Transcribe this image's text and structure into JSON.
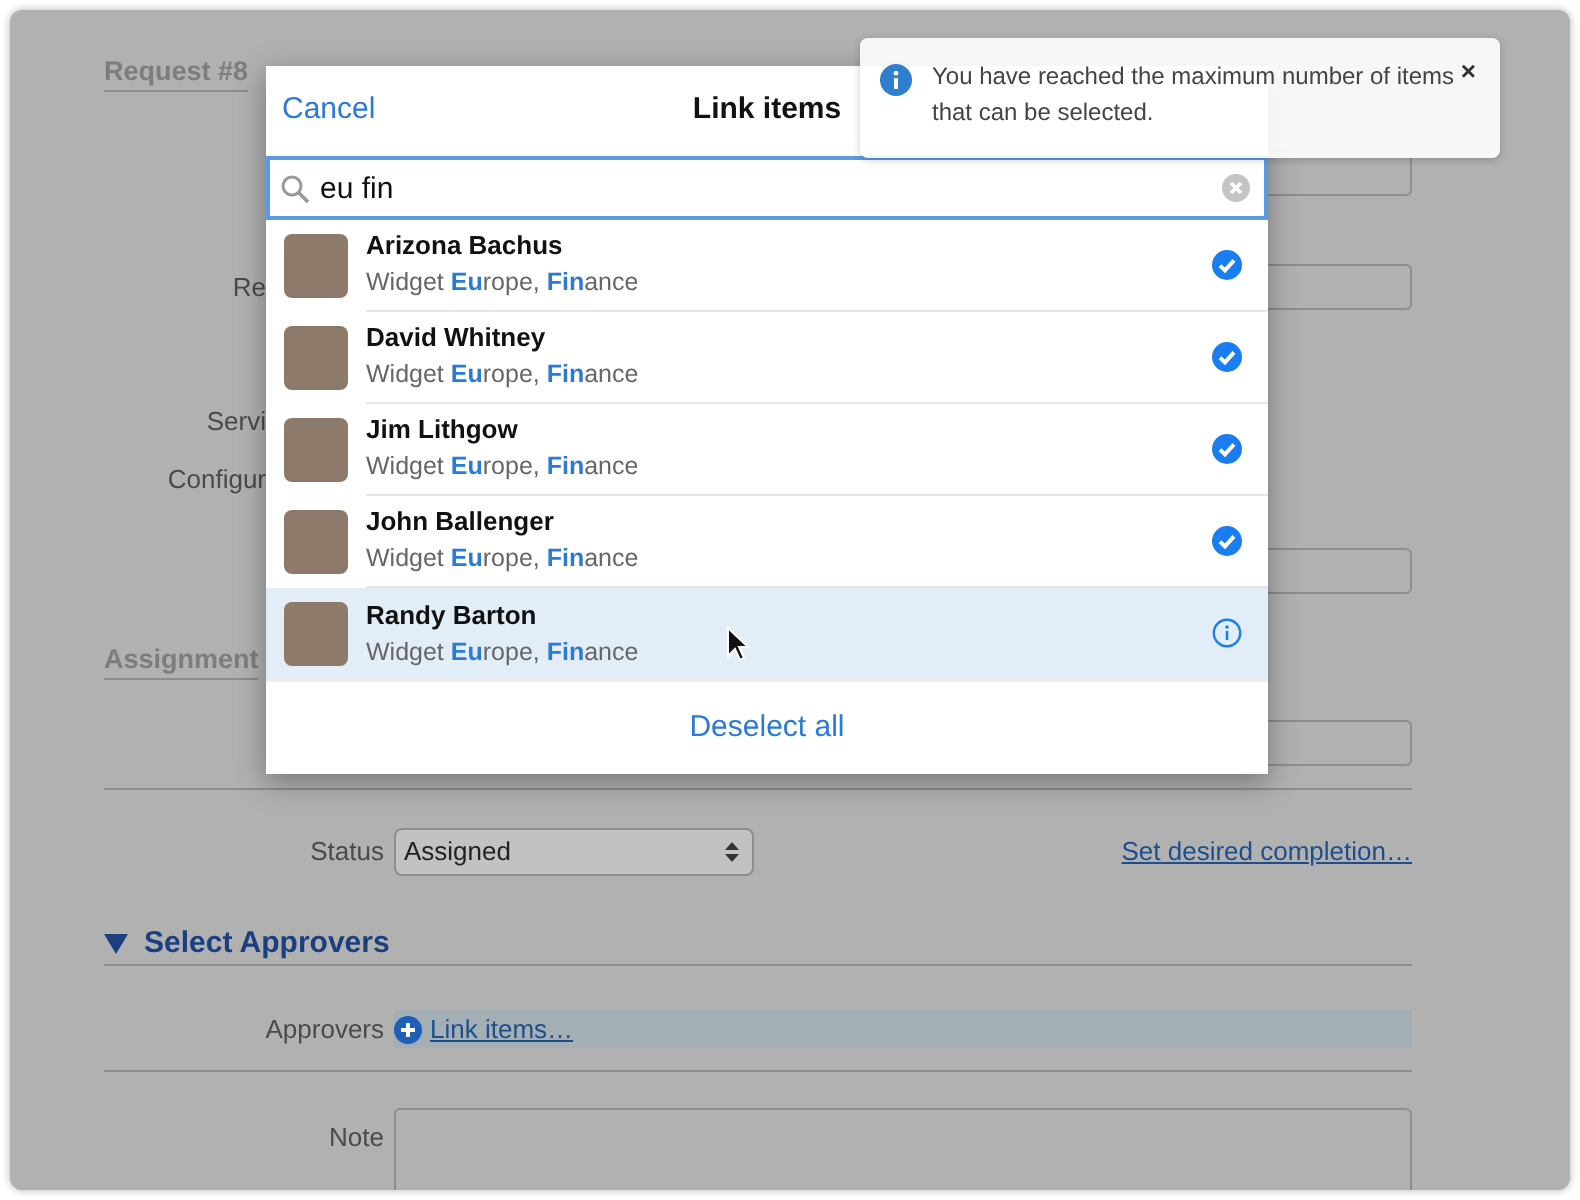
{
  "form_items": [
    {
      "kind": "heading",
      "text": "Request #8"
    },
    {
      "kind": "field"
    },
    {
      "kind": "label_field",
      "label": "Re"
    },
    {
      "kind": "label",
      "label": "Servi"
    },
    {
      "kind": "label",
      "label": "Configur"
    },
    {
      "kind": "field"
    },
    {
      "kind": "heading",
      "text": "Assignment"
    },
    {
      "kind": "field"
    },
    {
      "kind": "select",
      "label": "Status",
      "value": "Assigned",
      "link": "Set desired completion…"
    },
    {
      "kind": "section",
      "text": "Select Approvers",
      "expanded": true
    },
    {
      "kind": "link_row",
      "label": "Approvers",
      "link": "Link items…"
    },
    {
      "kind": "textarea",
      "label": "Note"
    }
  ],
  "dialog": {
    "cancel": "Cancel",
    "title": "Link items",
    "search": {
      "value": "eu fin"
    },
    "items": [
      {
        "name": "Arizona Bachus",
        "subtitle": "Widget **Eu**rope, **Fin**ance",
        "selected": true,
        "highlighted": false
      },
      {
        "name": "David Whitney",
        "subtitle": "Widget **Eu**rope, **Fin**ance",
        "selected": true,
        "highlighted": false
      },
      {
        "name": "Jim Lithgow",
        "subtitle": "Widget **Eu**rope, **Fin**ance",
        "selected": true,
        "highlighted": false
      },
      {
        "name": "John Ballenger",
        "subtitle": "Widget **Eu**rope, **Fin**ance",
        "selected": true,
        "highlighted": false
      },
      {
        "name": "Randy Barton",
        "subtitle": "Widget **Eu**rope, **Fin**ance",
        "selected": false,
        "highlighted": true
      }
    ],
    "footer": "Deselect all"
  },
  "toast": {
    "message": "You have reached the maximum number of items that can be selected.",
    "close": "×"
  }
}
